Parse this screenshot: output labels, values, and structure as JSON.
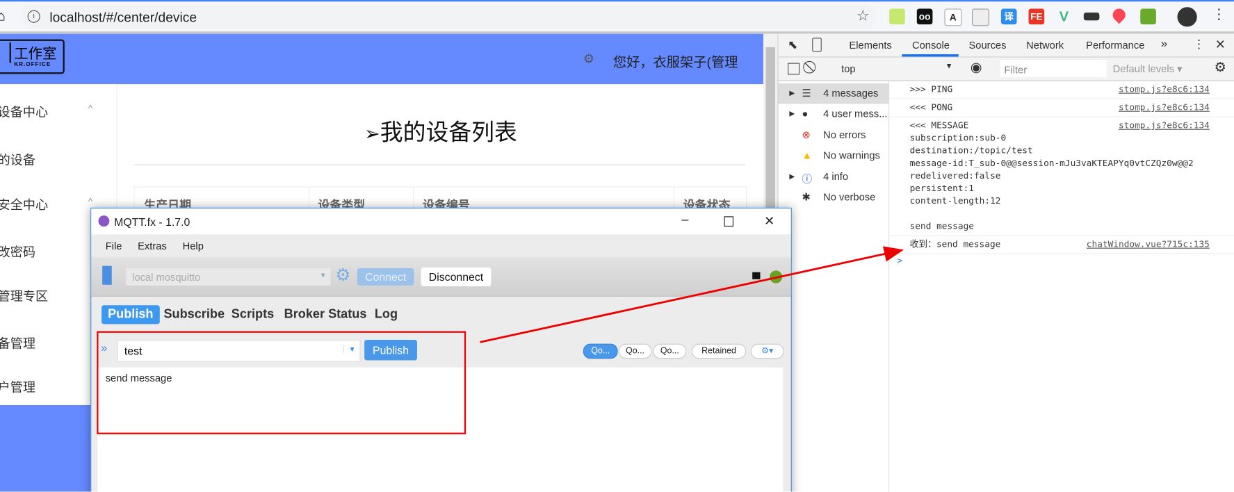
{
  "browser": {
    "url": "localhost/#/center/device",
    "extensions": [
      "forest-icon",
      "tampermonkey-icon",
      "translate-a-icon",
      "screenshot-icon",
      "yi-translate-icon",
      "fe-icon",
      "vue-devtools-icon",
      "incognito-icon",
      "location-pin-icon",
      "printer-icon"
    ]
  },
  "app": {
    "logo": {
      "text": "工作室",
      "sub": "KR.OFFICE"
    },
    "greeting": "您好，衣服架子(管理",
    "sidebar": [
      {
        "label": "设备中心",
        "expandable": true
      },
      {
        "label": "的设备"
      },
      {
        "label": "安全中心",
        "expandable": true
      },
      {
        "label": "改密码"
      },
      {
        "label": "管理专区"
      },
      {
        "label": "备管理"
      },
      {
        "label": "户管理"
      }
    ],
    "title": "我的设备列表",
    "table_headers": [
      "生产日期",
      "设备类型",
      "设备编号",
      "设备状态"
    ],
    "header_color": "#6589ff"
  },
  "devtools": {
    "tabs": [
      "Elements",
      "Console",
      "Sources",
      "Network",
      "Performance"
    ],
    "active_tab": "Console",
    "more": "»",
    "context": "top",
    "filter_placeholder": "Filter",
    "levels": "Default levels ▾",
    "sidebar": [
      {
        "label": "4 messages",
        "icon": "list-icon",
        "expandable": true
      },
      {
        "label": "4 user mess...",
        "icon": "user-icon",
        "expandable": true
      },
      {
        "label": "No errors",
        "icon": "error-icon"
      },
      {
        "label": "No warnings",
        "icon": "warning-icon"
      },
      {
        "label": "4 info",
        "icon": "info-icon",
        "expandable": true
      },
      {
        "label": "No verbose",
        "icon": "bug-icon"
      }
    ],
    "messages": [
      {
        "lines": [
          ">>> PING"
        ],
        "source": "stomp.js?e8c6:134"
      },
      {
        "lines": [
          "<<< PONG"
        ],
        "source": "stomp.js?e8c6:134"
      },
      {
        "lines": [
          "<<< MESSAGE",
          "subscription:sub-0",
          "destination:/topic/test",
          "message-id:T_sub-0@@session-mJu3vaKTEAPYq0vtCZQz0w@@2",
          "redelivered:false",
          "persistent:1",
          "content-length:12",
          "",
          "send message"
        ],
        "source": "stomp.js?e8c6:134"
      },
      {
        "lines": [
          "收到：send message"
        ],
        "source": "chatWindow.vue?715c:135"
      }
    ],
    "prompt": ">"
  },
  "mqtt": {
    "title": "MQTT.fx - 1.7.0",
    "menu": [
      "File",
      "Extras",
      "Help"
    ],
    "profile": "local mosquitto",
    "connect": "Connect",
    "disconnect": "Disconnect",
    "status_color": "#6aa121",
    "tabs": [
      "Publish",
      "Subscribe",
      "Scripts",
      "Broker Status",
      "Log"
    ],
    "active_tab": "Publish",
    "topic": "test",
    "publish": "Publish",
    "qos": [
      "Qo...",
      "Qo...",
      "Qo..."
    ],
    "retained": "Retained",
    "message": "send message"
  }
}
